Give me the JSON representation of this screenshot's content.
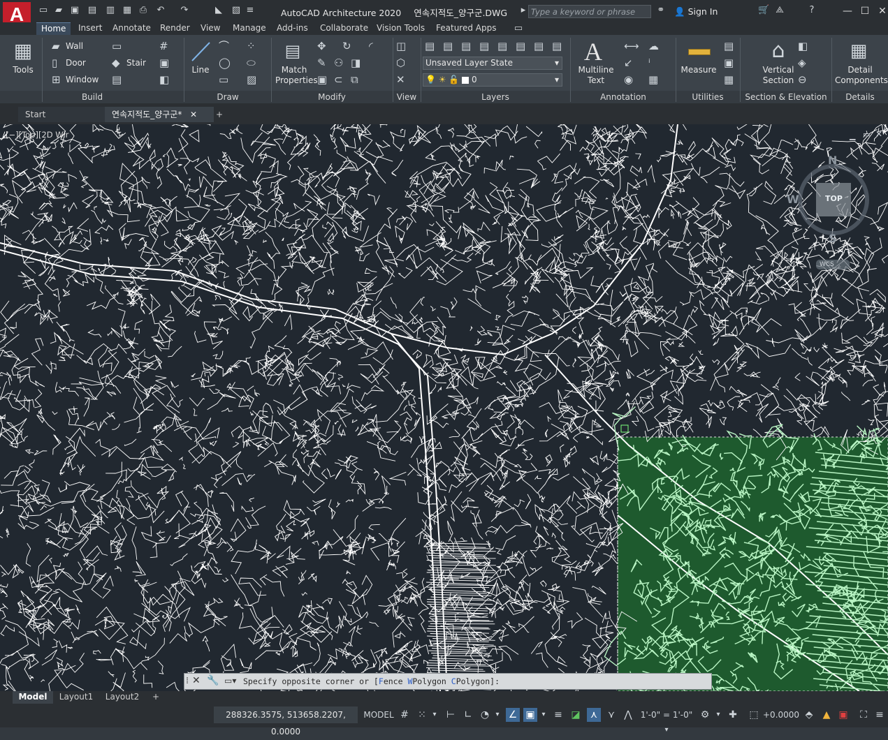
{
  "app": {
    "logo_letter": "A",
    "logo_sub": "A",
    "title": "AutoCAD Architecture 2020",
    "document": "연속지적도_양구군.DWG",
    "search_placeholder": "Type a keyword or phrase",
    "sign_in": "Sign In"
  },
  "ribbon_tabs": [
    "Home",
    "Insert",
    "Annotate",
    "Render",
    "View",
    "Manage",
    "Add-ins",
    "Collaborate",
    "Vision Tools",
    "Featured Apps"
  ],
  "ribbon": {
    "tools_label": "Tools",
    "build": {
      "title": "Build",
      "wall": "Wall",
      "door": "Door",
      "window": "Window",
      "stair": "Stair"
    },
    "draw": {
      "title": "Draw",
      "line": "Line"
    },
    "modify": {
      "title": "Modify",
      "match_1": "Match",
      "match_2": "Properties"
    },
    "view": {
      "title": "View"
    },
    "layers": {
      "title": "Layers",
      "layer_state": "Unsaved Layer State",
      "current_layer": "0"
    },
    "annotation": {
      "title": "Annotation",
      "mtext_1": "Multiline",
      "mtext_2": "Text"
    },
    "utilities": {
      "title": "Utilities",
      "measure": "Measure"
    },
    "section": {
      "title": "Section & Elevation",
      "vs_1": "Vertical",
      "vs_2": "Section"
    },
    "details": {
      "title": "Details",
      "dc_1": "Detail",
      "dc_2": "Components"
    }
  },
  "doc_tabs": {
    "start": "Start",
    "drawing": "연속지적도_양구군*"
  },
  "viewport": {
    "label": "[−][Top][2D Wir",
    "viewcube_top": "TOP",
    "compass": {
      "n": "N",
      "s": "S",
      "w": "W"
    },
    "wcs": "WCS"
  },
  "command_line": {
    "prefix": "Specify opposite corner or [",
    "f_key": "F",
    "f_rest": "ence ",
    "w_key": "W",
    "w_rest": "Polygon ",
    "c_key": "C",
    "c_rest": "Polygon",
    "suffix": "]:"
  },
  "layout_tabs": [
    "Model",
    "Layout1",
    "Layout2"
  ],
  "status": {
    "coordinates": "288326.3575, 513658.2207, 0.0000",
    "space": "MODEL",
    "scale": "1'-0\" = 1'-0\"",
    "elevation": "+0.0000"
  },
  "colors": {
    "canvas_bg": "#212830",
    "linework": "#ffffff",
    "selection_fill": "#1e5a2e",
    "selection_line": "#b9f5c4",
    "accent": "#c51f2b"
  }
}
